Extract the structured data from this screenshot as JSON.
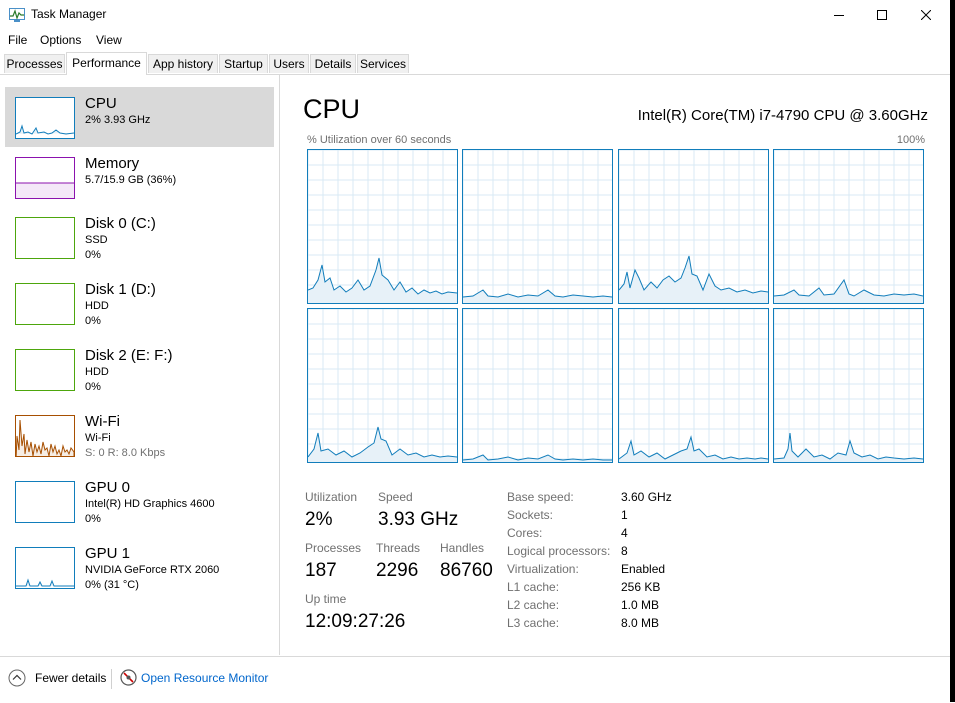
{
  "window": {
    "title": "Task Manager"
  },
  "menu": [
    "File",
    "Options",
    "View"
  ],
  "tabs": [
    "Processes",
    "Performance",
    "App history",
    "Startup",
    "Users",
    "Details",
    "Services"
  ],
  "sidebar": {
    "items": [
      {
        "name": "CPU",
        "line1": "2%  3.93 GHz",
        "line2": "",
        "icon": "cpu-graph"
      },
      {
        "name": "Memory",
        "line1": "5.7/15.9 GB (36%)",
        "line2": "",
        "icon": "memory-graph"
      },
      {
        "name": "Disk 0 (C:)",
        "line1": "SSD",
        "line2": "0%",
        "icon": "disk-graph"
      },
      {
        "name": "Disk 1 (D:)",
        "line1": "HDD",
        "line2": "0%",
        "icon": "disk-graph"
      },
      {
        "name": "Disk 2 (E: F:)",
        "line1": "HDD",
        "line2": "0%",
        "icon": "disk-graph"
      },
      {
        "name": "Wi-Fi",
        "line1": "Wi-Fi",
        "line2": "S: 0  R: 8.0 Kbps",
        "icon": "network-graph"
      },
      {
        "name": "GPU 0",
        "line1": "Intel(R) HD Graphics 4600",
        "line2": "0%",
        "icon": "gpu-graph"
      },
      {
        "name": "GPU 1",
        "line1": "NVIDIA GeForce RTX 2060",
        "line2": "0%  (31 °C)",
        "icon": "gpu-graph"
      }
    ]
  },
  "main": {
    "title": "CPU",
    "model": "Intel(R) Core(TM) i7-4790 CPU @ 3.60GHz",
    "util_label": "% Utilization over 60 seconds",
    "max_label": "100%",
    "stats": {
      "utilization_label": "Utilization",
      "utilization": "2%",
      "speed_label": "Speed",
      "speed": "3.93 GHz",
      "processes_label": "Processes",
      "processes": "187",
      "threads_label": "Threads",
      "threads": "2296",
      "handles_label": "Handles",
      "handles": "86760",
      "uptime_label": "Up time",
      "uptime": "12:09:27:26"
    },
    "specs": [
      {
        "label": "Base speed:",
        "value": "3.60 GHz"
      },
      {
        "label": "Sockets:",
        "value": "1"
      },
      {
        "label": "Cores:",
        "value": "4"
      },
      {
        "label": "Logical processors:",
        "value": "8"
      },
      {
        "label": "Virtualization:",
        "value": "Enabled"
      },
      {
        "label": "L1 cache:",
        "value": "256 KB"
      },
      {
        "label": "L2 cache:",
        "value": "1.0 MB"
      },
      {
        "label": "L3 cache:",
        "value": "8.0 MB"
      }
    ]
  },
  "footer": {
    "fewer_details": "Fewer details",
    "resource_monitor": "Open Resource Monitor"
  },
  "colors": {
    "cpu": "#117dbb",
    "memory": "#8b12ae",
    "disk": "#4da60c",
    "wifi": "#a74f01",
    "gpu": "#117dbb",
    "selected": "#d9d9d9",
    "link": "#0066cc"
  }
}
